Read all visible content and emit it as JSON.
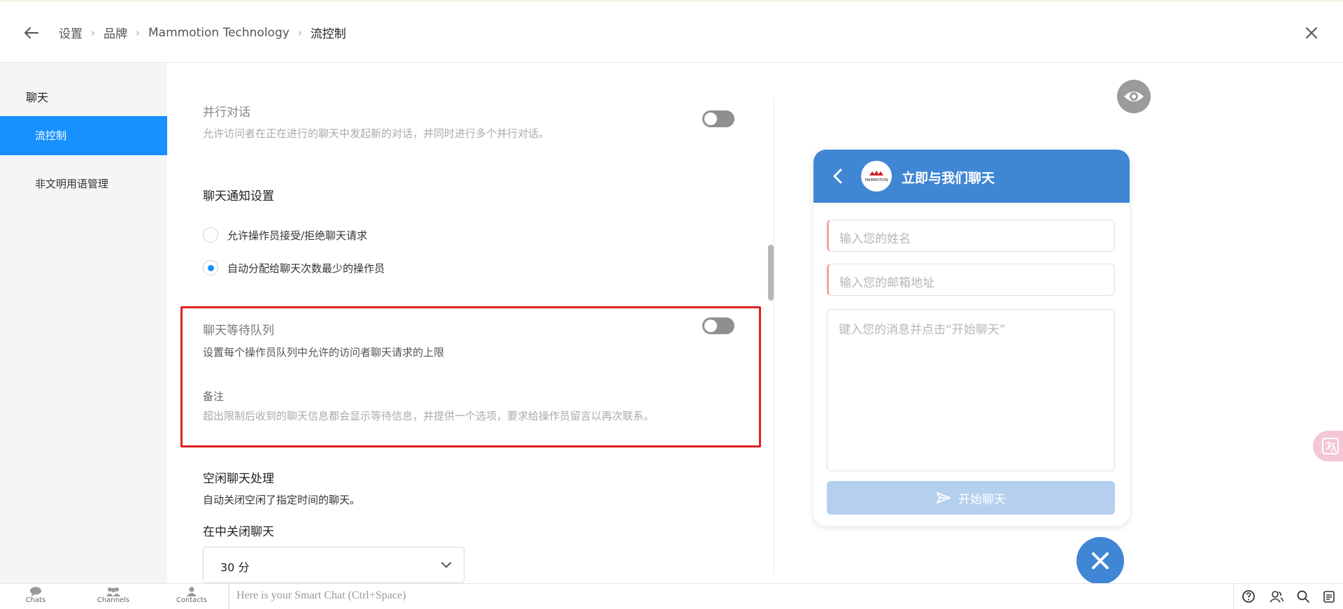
{
  "header": {
    "breadcrumbs": [
      "设置",
      "品牌",
      "Mammotion Technology",
      "流控制"
    ]
  },
  "sidebar": {
    "section_title": "聊天",
    "items": [
      {
        "label": "流控制",
        "active": true
      },
      {
        "label": "非文明用语管理",
        "active": false
      }
    ]
  },
  "settings": {
    "parallel": {
      "title": "并行对话",
      "description": "允许访问者在正在进行的聊天中发起新的对话，并同时进行多个并行对话。",
      "enabled": false
    },
    "notification": {
      "title": "聊天通知设置",
      "options": [
        {
          "label": "允许操作员接受/拒绝聊天请求",
          "selected": false
        },
        {
          "label": "自动分配给聊天次数最少的操作员",
          "selected": true
        }
      ]
    },
    "queue": {
      "title": "聊天等待队列",
      "description": "设置每个操作员队列中允许的访问者聊天请求的上限",
      "note_title": "备注",
      "note_text": "超出限制后收到的聊天信息都会显示等待信息，并提供一个选项，要求给操作员留言以再次联系。",
      "enabled": false
    },
    "idle": {
      "title": "空闲聊天处理",
      "description": "自动关闭空闲了指定时间的聊天。",
      "close_label": "在中关闭聊天",
      "close_after_value": "30 分"
    }
  },
  "preview": {
    "widget_title": "立即与我们聊天",
    "name_placeholder": "输入您的姓名",
    "email_placeholder": "输入您的邮箱地址",
    "message_placeholder": "键入您的消息并点击“开始聊天”",
    "submit_label": "开始聊天",
    "logo_text": "MAMMOTION",
    "accent_color": "#3f86d4",
    "icons": [
      "eye-icon",
      "chevron-left-icon",
      "send-icon",
      "close-icon",
      "translate-icon"
    ]
  },
  "bottom_bar": {
    "tabs": [
      "Chats",
      "Channels",
      "Contacts"
    ],
    "smart_chat_placeholder": "Here is your Smart Chat (Ctrl+Space)",
    "right_icons": [
      "help-icon",
      "agents-icon",
      "search-icon",
      "notes-icon"
    ]
  }
}
